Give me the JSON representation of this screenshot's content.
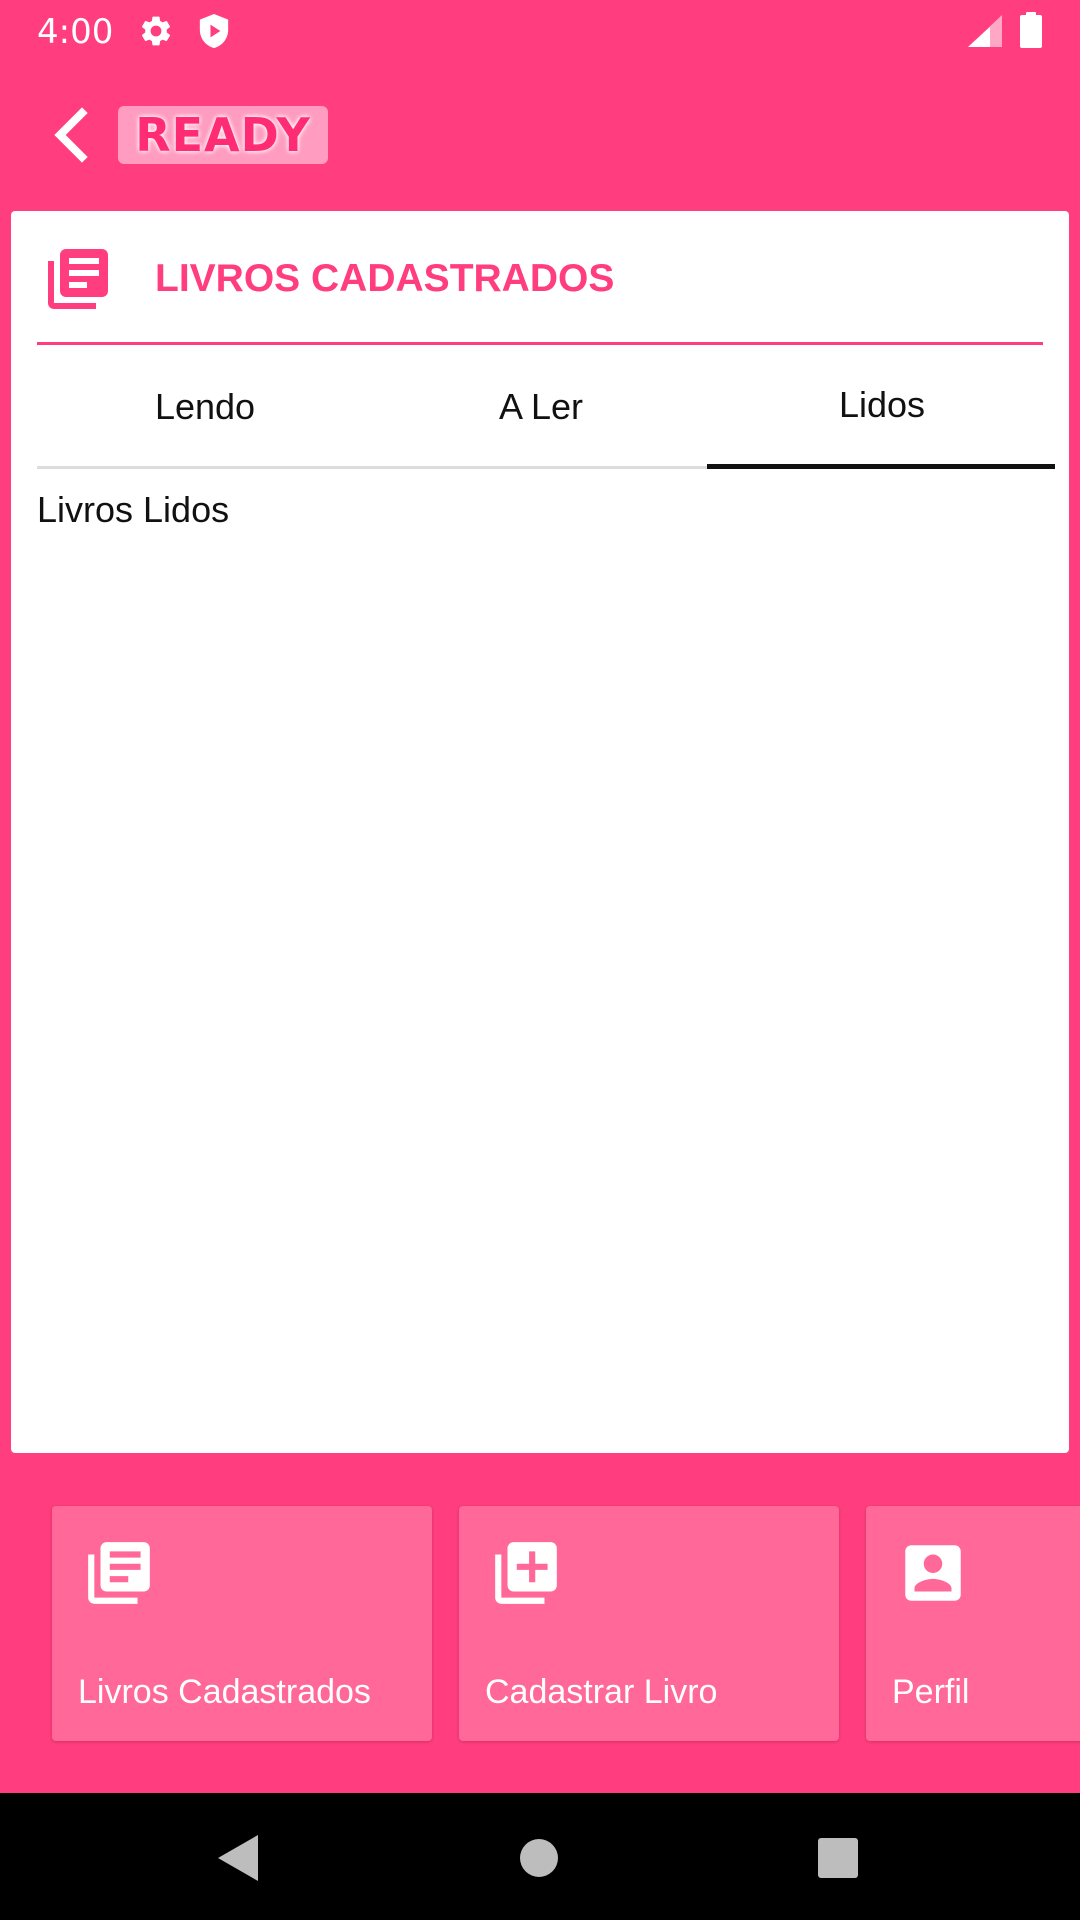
{
  "status_bar": {
    "time": "4:00",
    "icons": [
      "gear-icon",
      "shield-play-icon",
      "signal-icon",
      "battery-icon"
    ]
  },
  "app_bar": {
    "back_icon": "chevron-left-icon",
    "logo_text": "READY"
  },
  "header": {
    "icon": "book-list-icon",
    "title": "LIVROS CADASTRADOS"
  },
  "tabs": [
    {
      "label": "Lendo",
      "selected": false
    },
    {
      "label": "A Ler",
      "selected": false
    },
    {
      "label": "Lidos",
      "selected": true
    }
  ],
  "tab_content": {
    "label": "Livros Lidos"
  },
  "bottom_nav": [
    {
      "icon": "book-list-icon",
      "label": "Livros Cadastrados"
    },
    {
      "icon": "add-book-icon",
      "label": "Cadastrar Livro"
    },
    {
      "icon": "profile-icon",
      "label": "Perfil"
    }
  ],
  "system_nav": {
    "icons": [
      "back-triangle-icon",
      "home-circle-icon",
      "recents-square-icon"
    ]
  },
  "colors": {
    "primary": "#FF3D7F",
    "nav_card": "#FF6898",
    "surface": "#FFFFFF",
    "text": "#111111"
  }
}
